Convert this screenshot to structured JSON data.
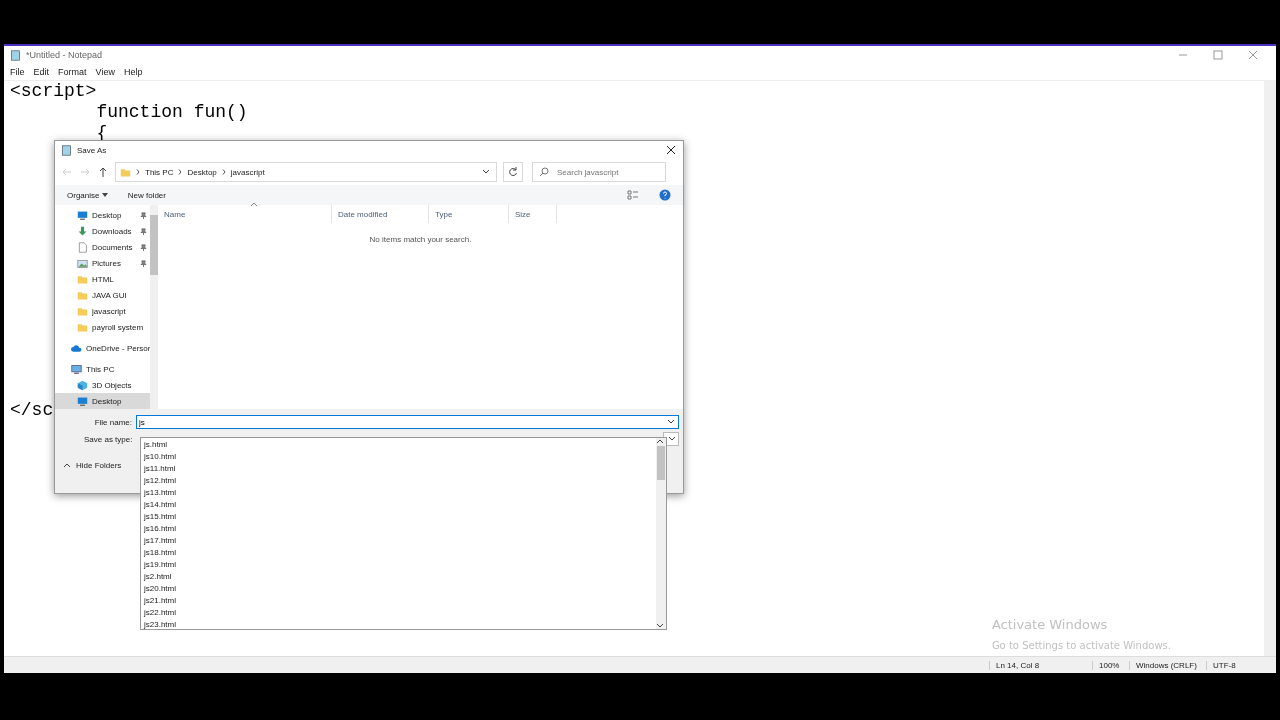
{
  "notepad": {
    "title": "*Untitled - Notepad",
    "menu": [
      "File",
      "Edit",
      "Format",
      "View",
      "Help"
    ],
    "lines": [
      "<script>",
      "        function fun()",
      "        {"
    ],
    "cut_line": "</sc",
    "activation": {
      "title": "Activate Windows",
      "subtitle": "Go to Settings to activate Windows."
    },
    "status_bar": [
      "Ln 14, Col 8",
      "100%",
      "Windows (CRLF)",
      "UTF-8"
    ]
  },
  "dialog": {
    "title": "Save As",
    "breadcrumb": [
      "This PC",
      "Desktop",
      "javascript"
    ],
    "search": {
      "placeholder": "Search javascript"
    },
    "toolbar": {
      "organise": "Organise",
      "new_folder": "New folder"
    },
    "quick_access": [
      {
        "label": "Desktop",
        "kind": "desktop",
        "pinned": true,
        "selected": false
      },
      {
        "label": "Downloads",
        "kind": "download",
        "pinned": true,
        "selected": false
      },
      {
        "label": "Documents",
        "kind": "document",
        "pinned": true,
        "selected": false
      },
      {
        "label": "Pictures",
        "kind": "picture",
        "pinned": true,
        "selected": false
      },
      {
        "label": "HTML",
        "kind": "folder",
        "pinned": false,
        "selected": false
      },
      {
        "label": "JAVA GUI",
        "kind": "folder",
        "pinned": false,
        "selected": false
      },
      {
        "label": "javascript",
        "kind": "folder",
        "pinned": false,
        "selected": false
      },
      {
        "label": "payroll system",
        "kind": "folder",
        "pinned": false,
        "selected": false
      }
    ],
    "locations": [
      {
        "label": "OneDrive - Persor",
        "kind": "cloud",
        "selected": false
      },
      {
        "label": "This PC",
        "kind": "pc",
        "selected": false,
        "children": [
          {
            "label": "3D Objects",
            "kind": "objects",
            "selected": false
          },
          {
            "label": "Desktop",
            "kind": "desktop",
            "selected": true
          }
        ]
      }
    ],
    "columns": [
      "Name",
      "Date modified",
      "Type",
      "Size"
    ],
    "empty_message": "No items match your search.",
    "file_name": {
      "label": "File name:",
      "value": "js"
    },
    "save_as_type": {
      "label": "Save as type:"
    },
    "hide_folders": "Hide Folders",
    "suggestions": [
      "js.html",
      "js10.html",
      "js11.html",
      "js12.html",
      "js13.html",
      "js14.html",
      "js15.html",
      "js16.html",
      "js17.html",
      "js18.html",
      "js19.html",
      "js2.html",
      "js20.html",
      "js21.html",
      "js22.html",
      "js23.html"
    ]
  }
}
